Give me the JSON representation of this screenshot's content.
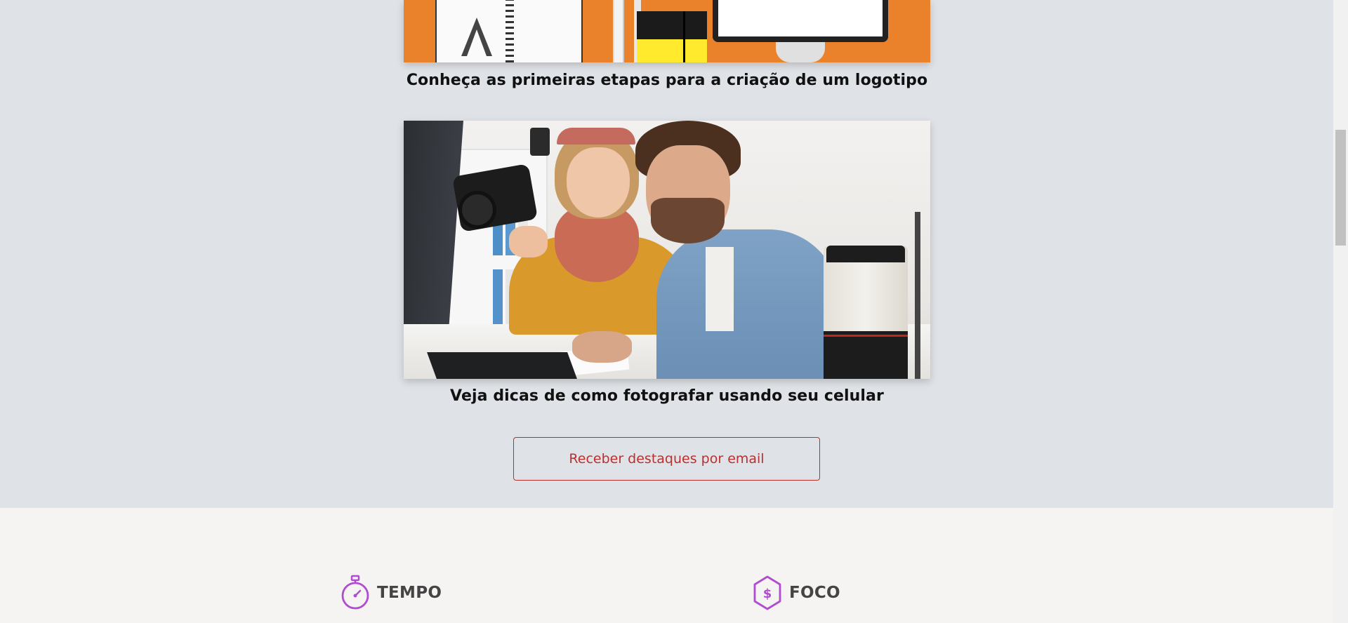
{
  "articles": [
    {
      "title": "Conheça as primeiras etapas para a criação de um logotipo",
      "image_alt": "design workspace illustration"
    },
    {
      "title": "Veja dicas de como fotografar usando seu celular",
      "image_alt": "photographers looking at camera"
    }
  ],
  "cta": {
    "label": "Receber destaques por email"
  },
  "features": [
    {
      "label": "TEMPO",
      "icon": "stopwatch-icon"
    },
    {
      "label": "FOCO",
      "icon": "dollar-hexagon-icon"
    }
  ],
  "colors": {
    "blog_background": "#dfe2e6",
    "features_background": "#f6f4f3",
    "cta_accent": "#b8302f",
    "icon_accent": "#b04ccf",
    "image1_background": "#e9822b"
  }
}
